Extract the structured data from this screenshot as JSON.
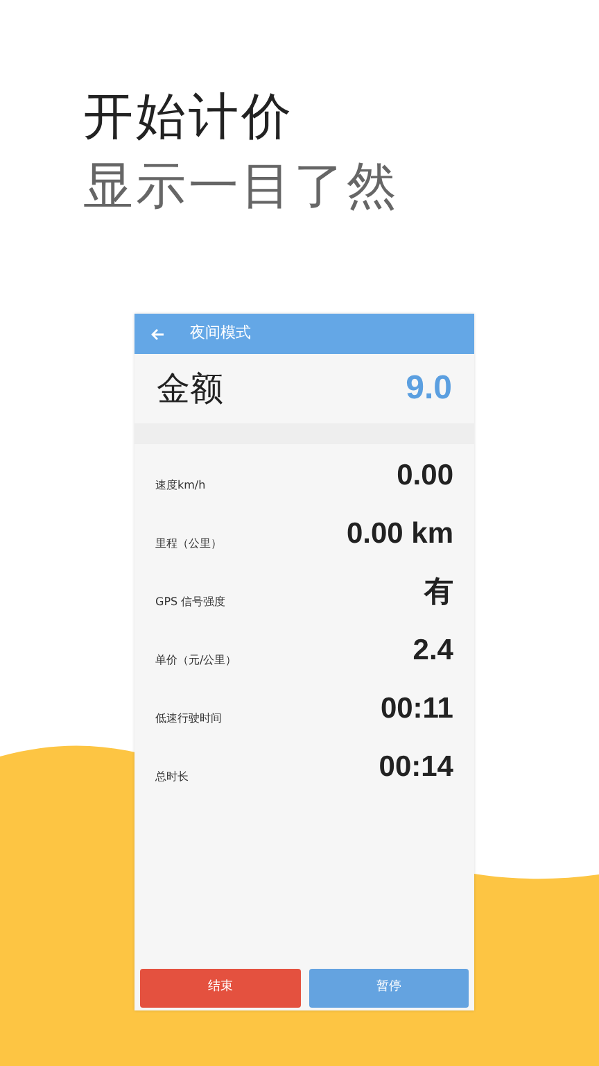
{
  "headline": [
    "开始计价",
    "显示一目了然"
  ],
  "app": {
    "title": "夜间模式",
    "amount": {
      "label": "金额",
      "value": "9.0"
    },
    "rows": [
      {
        "label": "速度km/h",
        "value": "0.00"
      },
      {
        "label": "里程（公里）",
        "value": "0.00 km"
      },
      {
        "label": "GPS 信号强度",
        "value": "有"
      },
      {
        "label": "单价（元/公里）",
        "value": "2.4"
      },
      {
        "label": "低速行驶时间",
        "value": "00:11"
      },
      {
        "label": "总时长",
        "value": "00:14"
      }
    ],
    "buttons": [
      {
        "label": "结束",
        "color": "#e4513f"
      },
      {
        "label": "暂停",
        "color": "#64a3e0"
      }
    ]
  }
}
